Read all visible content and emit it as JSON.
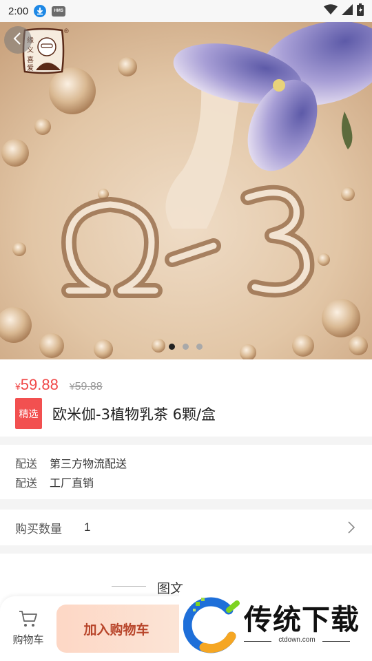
{
  "status_bar": {
    "time": "2:00",
    "icons": [
      "download-icon",
      "hms-icon",
      "wifi-icon",
      "signal-icon",
      "battery-icon"
    ],
    "hms_label": "HMS"
  },
  "hero": {
    "logo_text": "缘义喜爱",
    "reg_mark": "®",
    "slide_count": 3,
    "active_slide": 1
  },
  "product": {
    "currency": "¥",
    "price": "59.88",
    "old_currency": "¥",
    "old_price": "59.88",
    "tag": "精选",
    "title": "欧米伽-3植物乳茶 6颗/盒"
  },
  "delivery": [
    {
      "label": "配送",
      "value": "第三方物流配送"
    },
    {
      "label": "配送",
      "value": "工厂直销"
    }
  ],
  "quantity": {
    "label": "购买数量",
    "value": "1"
  },
  "detail": {
    "title": "图文"
  },
  "bottom_bar": {
    "cart_label": "购物车",
    "add_to_cart": "加入购物车"
  },
  "watermark": {
    "title": "传统下载",
    "url": "ctdown.com"
  },
  "colors": {
    "price": "#f04848",
    "tag_bg": "#f25050",
    "add_cart_text": "#b8452a"
  }
}
